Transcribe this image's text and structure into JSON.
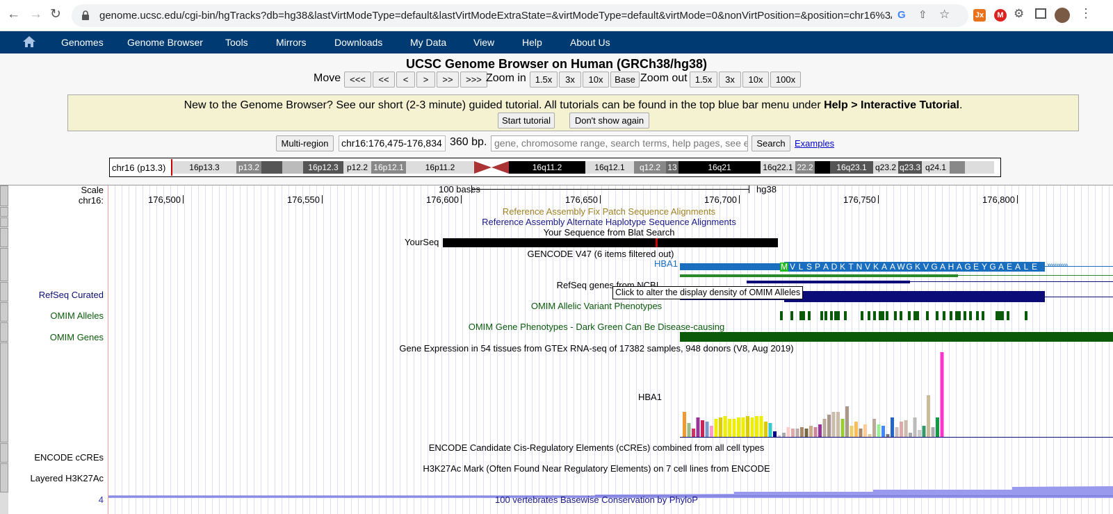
{
  "browser": {
    "url": "genome.ucsc.edu/cgi-bin/hgTracks?db=hg38&lastVirtModeType=default&lastVirtModeExtraState=&virtModeType=default&virtMode=0&nonVirtPosition=&position=chr16%3A176...",
    "ext_badge": "Jx"
  },
  "nav": {
    "items": [
      "Genomes",
      "Genome Browser",
      "Tools",
      "Mirrors",
      "Downloads",
      "My Data",
      "View",
      "Help",
      "About Us"
    ]
  },
  "page_title": "UCSC Genome Browser on Human (GRCh38/hg38)",
  "controls": {
    "move_label": "Move",
    "move_buttons": [
      "<<<",
      "<<",
      "<",
      ">",
      ">>",
      ">>>"
    ],
    "zoom_in_label": "Zoom in",
    "zoom_in_buttons": [
      "1.5x",
      "3x",
      "10x",
      "Base"
    ],
    "zoom_out_label": "Zoom out",
    "zoom_out_buttons": [
      "1.5x",
      "3x",
      "10x",
      "100x"
    ]
  },
  "tutorial": {
    "text_pre": "New to the Genome Browser? See our short (2-3 minute) guided tutorial. All tutorials can be found in the top blue bar menu under ",
    "text_bold": "Help > Interactive Tutorial",
    "text_post": ".",
    "start_button": "Start tutorial",
    "dismiss_button": "Don't show again"
  },
  "position": {
    "multiregion_button": "Multi-region",
    "value": "chr16:176,475-176,834",
    "size": "360 bp.",
    "search_placeholder": "gene, chromosome range, search terms, help pages, see examples",
    "search_button": "Search",
    "examples_link": "Examples"
  },
  "ideogram": {
    "chrom": "chr16 (p13.3)",
    "bands": [
      "16p13.3",
      "p13.2",
      "16p12.3",
      "p12.2",
      "16p12.1",
      "16p11.2",
      "16q11.2",
      "16q12.1",
      "q12.2",
      "13",
      "16q21",
      "16q22.1",
      "22.2",
      "16q23.1",
      "q23.2",
      "q23.3",
      "q24.1"
    ]
  },
  "tracks": {
    "scale_label": "Scale",
    "chrom_label": "chr16:",
    "scale_bar_label": "100 bases",
    "assembly": "hg38",
    "ticks": [
      "176,500",
      "176,550",
      "176,600",
      "176,650",
      "176,700",
      "176,750",
      "176,800"
    ],
    "fix_patch_title": "Reference Assembly Fix Patch Sequence Alignments",
    "alt_haplo_title": "Reference Assembly Alternate Haplotype Sequence Alignments",
    "blat_title": "Your Sequence from Blat Search",
    "blat_item": "YourSeq",
    "gencode_title": "GENCODE V47 (6 items filtered out)",
    "gene_name": "HBA1",
    "amino_acids": [
      "M",
      "V",
      "L",
      "S",
      "P",
      "A",
      "D",
      "K",
      "T",
      "N",
      "V",
      "K",
      "A",
      "A",
      "W",
      "G",
      "K",
      "V",
      "G",
      "A",
      "H",
      "A",
      "G",
      "E",
      "Y",
      "G",
      "A",
      "E",
      "A",
      "L",
      "E"
    ],
    "refseq_title": "RefSeq genes from NCBI",
    "refseq_label": "RefSeq Curated",
    "tooltip": "Click to alter the display density of OMIM Alleles",
    "omim_alleles_label": "OMIM Alleles",
    "omim_alleles_title": "OMIM Allelic Variant Phenotypes",
    "omim_genes_label": "OMIM Genes",
    "omim_genes_title": "OMIM Gene Phenotypes - Dark Green Can Be Disease-causing",
    "gtex_title": "Gene Expression in 54 tissues from GTEx RNA-seq of 17382 samples, 948 donors (V8, Aug 2019)",
    "gtex_gene": "HBA1",
    "encode_label": "ENCODE cCREs",
    "encode_title": "ENCODE Candidate Cis-Regulatory Elements (cCREs) combined from all cell types",
    "h3k27_label": "Layered H3K27Ac",
    "h3k27_title": "H3K27Ac Mark (Often Found Near Regulatory Elements) on 7 cell lines from ENCODE",
    "phylop_axis": "4",
    "phylop_title": "100 vertebrates Basewise Conservation by PhyloP"
  },
  "gtex_bars": [
    18,
    10,
    6,
    14,
    12,
    11,
    8,
    13,
    14,
    15,
    13,
    13,
    14,
    14,
    15,
    14,
    15,
    15,
    11,
    10,
    4,
    1,
    3,
    7,
    6,
    6,
    7,
    6,
    8,
    7,
    9,
    13,
    16,
    18,
    18,
    13,
    22,
    8,
    11,
    6,
    9,
    2,
    13,
    9,
    8,
    2,
    14,
    7,
    11,
    12,
    3,
    14,
    5,
    8,
    30,
    7,
    14,
    61
  ],
  "gtex_colors": [
    "#ee9933",
    "#99bb88",
    "#cc3366",
    "#993399",
    "#cc2255",
    "#7799cc",
    "#ff99cc",
    "#eeee00",
    "#ddcc00",
    "#eeee00",
    "#eeee00",
    "#eeee00",
    "#eeee00",
    "#eeee00",
    "#ddcc00",
    "#eeee00",
    "#eeee00",
    "#eeee00",
    "#ddcc00",
    "#33cccc",
    "#000088",
    "#ccbbcc",
    "#aaaaaa",
    "#ffcccc",
    "#ddaaaa",
    "#bbaaaa",
    "#aa8866",
    "#776644",
    "#ccaa88",
    "#cc8899",
    "#993399",
    "#bbaa99",
    "#aa9988",
    "#ccbbaa",
    "#ccbbaa",
    "#99cc33",
    "#aa9988",
    "#eecc66",
    "#ffbb55",
    "#aa8866",
    "#ffcc99",
    "#ddcc99",
    "#bbaa99",
    "#99ee99",
    "#4488ff",
    "#777777",
    "#2266cc",
    "#ccbbbb",
    "#ddaaaa",
    "#ccbbaa",
    "#aaaaaa",
    "#bbbbbb",
    "#cccccc",
    "#339966",
    "#ccbb99",
    "#aaaaaa",
    "#119944",
    "#ff33cc"
  ],
  "colors": {
    "nav_bg": "#003a72",
    "blat": "#000000",
    "gencode_cds": "#1a6ebf",
    "refseq": "#0c0c78",
    "omim": "#0a5a0a",
    "ccres": "#ff0000",
    "phylop": "#9999ee"
  }
}
